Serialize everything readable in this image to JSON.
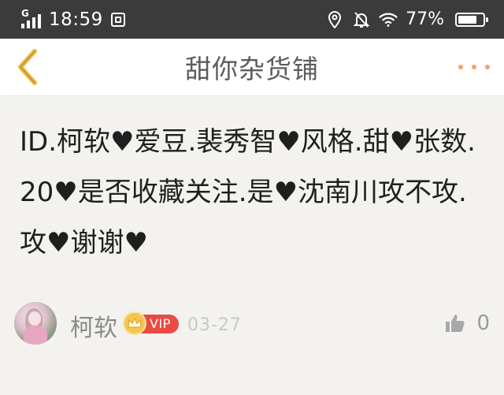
{
  "status_bar": {
    "network": "G",
    "time": "18:59",
    "battery": "77%",
    "battery_level": 0.77
  },
  "nav": {
    "title": "甜你杂货铺"
  },
  "post": {
    "segments": [
      {
        "text": "ID.柯软"
      },
      {
        "heart": "♥"
      },
      {
        "text": "爱豆.裴秀智"
      },
      {
        "heart": "♥"
      },
      {
        "text": "风格.甜"
      },
      {
        "heart": "♥"
      },
      {
        "text": "张数.20"
      },
      {
        "heart": "♥"
      },
      {
        "text": "是否收藏关注.是"
      },
      {
        "heart": "♥"
      },
      {
        "text": "沈南川攻不攻.攻"
      },
      {
        "heart": "♥"
      },
      {
        "text": "谢谢"
      },
      {
        "heart": "♥"
      }
    ]
  },
  "author": {
    "name": "柯软",
    "badge": "VIP",
    "date": "03-27"
  },
  "like": {
    "count": "0"
  },
  "colors": {
    "status_bar_bg": "#3b3b3b",
    "accent_back": "#f2bb3c",
    "more_dots": "#f2a36c",
    "vip_bg": "#e94b43",
    "page_bg": "#f3f2ee"
  }
}
